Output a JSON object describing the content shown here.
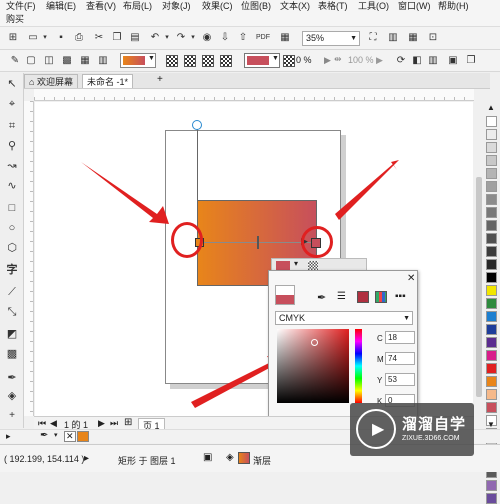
{
  "menu": {
    "items": [
      "文件(F)",
      "编辑(E)",
      "查看(V)",
      "布局(L)",
      "对象(J)",
      "效果(C)",
      "位图(B)",
      "文本(X)",
      "表格(T)",
      "工具(O)",
      "窗口(W)",
      "帮助(H)",
      "购买"
    ]
  },
  "toolbar": {
    "zoom_value": "35%"
  },
  "property_bar": {
    "transparency_value": "0 %",
    "opacity_value": "100 %"
  },
  "tabs": {
    "welcome": "欢迎屏幕",
    "document": "未命名 -1*"
  },
  "page_nav": {
    "page_count": "1 的 1",
    "page_label": "页 1"
  },
  "gradient_panel": {
    "color_model": "CMYK",
    "c_label": "C",
    "m_label": "M",
    "y_label": "Y",
    "k_label": "K",
    "c_value": "18",
    "m_value": "74",
    "y_value": "53",
    "k_value": "0"
  },
  "status": {
    "coordinates": "( 192.199, 154.114 )",
    "object_info": "矩形 于 图层 1",
    "fill_label": "渐层"
  },
  "watermark": {
    "title": "溜溜自学",
    "url": "ZIXUE.3D66.COM"
  },
  "colors": {
    "gradient_start": "#e8851a",
    "gradient_end": "#c74f5c",
    "highlight_red": "#e02020",
    "node_color": "#c74f5c"
  },
  "palette_colors": [
    "#ffffff",
    "#ededed",
    "#dadada",
    "#c8c8c8",
    "#b4b4b4",
    "#a0a0a0",
    "#8c8c8c",
    "#787878",
    "#646464",
    "#505050",
    "#3c3c3c",
    "#282828",
    "#000000",
    "#f2e600",
    "#2e8a3e",
    "#1c7fd0",
    "#1e3d9a",
    "#5b2c8f",
    "#d81c8a",
    "#e02020",
    "#e8851a",
    "#f6b98a",
    "#c74f5c",
    "#ffffff",
    "#e9e9e9",
    "#bdbdbd",
    "#8a8a8a",
    "#5a5a5a",
    "#9068b0",
    "#6a4c9c"
  ]
}
